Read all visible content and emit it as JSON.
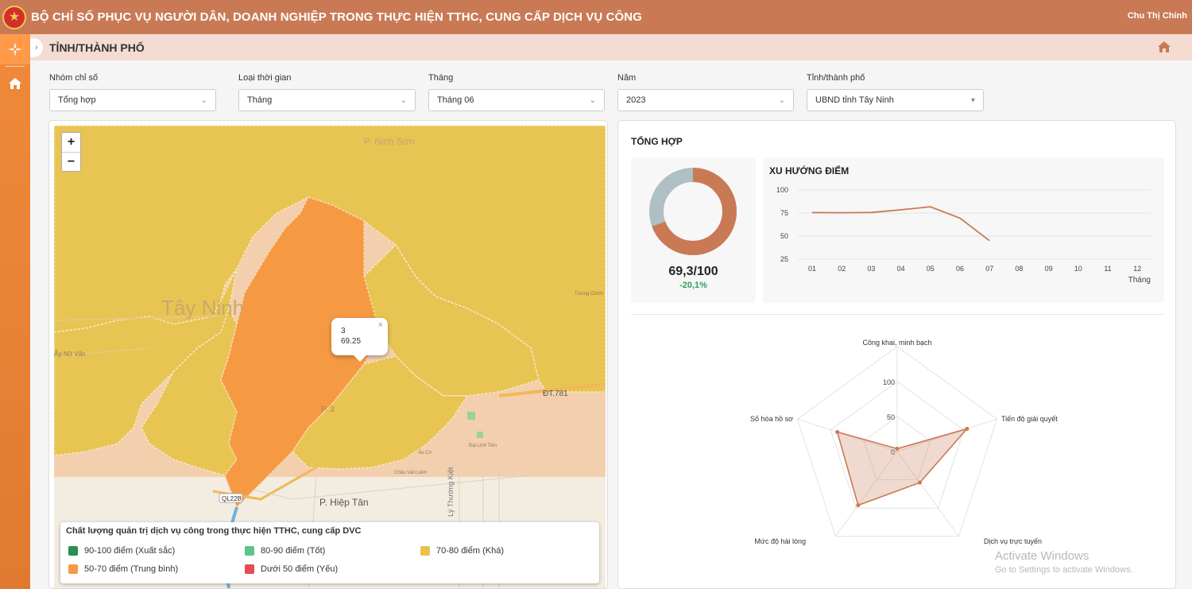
{
  "header": {
    "title": "BỘ CHỈ SỐ PHỤC VỤ NGƯỜI DÂN, DOANH NGHIỆP TRONG THỰC HIỆN TTHC, CUNG CẤP DỊCH VỤ CÔNG",
    "user": "Chu Thị Chinh"
  },
  "page": {
    "title": "TỈNH/THÀNH PHỐ"
  },
  "filters": [
    {
      "label": "Nhóm chỉ số",
      "value": "Tổng hợp"
    },
    {
      "label": "Loại thời gian",
      "value": "Tháng"
    },
    {
      "label": "Tháng",
      "value": "Tháng 06"
    },
    {
      "label": "Năm",
      "value": "2023"
    },
    {
      "label": "Tỉnh/thành phố",
      "value": "UBND tỉnh Tây Ninh"
    }
  ],
  "map": {
    "zoom_in": "+",
    "zoom_out": "−",
    "labels": {
      "ninh_son": "P. Ninh Sơn",
      "tay_ninh": "Tây Ninh",
      "hiep_tan": "P. Hiệp Tân",
      "dt781": "ĐT.781",
      "ql22b": "QL22B",
      "ly_thuong_kiet": "Lý Thường Kiệt",
      "nguyen_van_linh": "Ấp Nữ Văn",
      "tuong_chinh": "Tường Chính",
      "au_co": "Âu Cơ",
      "dai_linh_tien": "Đại Linh Tiên",
      "chau_van_liem": "Châu Văn Liêm",
      "p3": "P. 3"
    },
    "popup": {
      "id": "3",
      "value": "69.25",
      "close": "×"
    },
    "legend": {
      "title": "Chất lượng quản trị dịch vụ công trong thực hiện TTHC, cung cấp DVC",
      "items": [
        {
          "label": "90-100 điểm (Xuất sắc)",
          "color": "#2a8f4f"
        },
        {
          "label": "80-90 điểm (Tốt)",
          "color": "#5ec488"
        },
        {
          "label": "70-80 điểm (Khá)",
          "color": "#e8c24c"
        },
        {
          "label": "50-70 điểm (Trung bình)",
          "color": "#f59a42"
        },
        {
          "label": "Dưới 50 điểm (Yếu)",
          "color": "#e64b55"
        }
      ]
    }
  },
  "summary": {
    "title": "TỔNG HỢP",
    "score": "69,3/100",
    "delta": "-20,1%",
    "score_value": 69.3,
    "score_max": 100,
    "donut_colors": {
      "score": "#c97a55",
      "rest": "#b0bec5"
    }
  },
  "chart_data": [
    {
      "type": "line",
      "title": "XU HƯỚNG ĐIỂM",
      "xlabel": "Tháng",
      "ylabel": "",
      "x": [
        "01",
        "02",
        "03",
        "04",
        "05",
        "06",
        "07",
        "08",
        "09",
        "10",
        "11",
        "12"
      ],
      "yticks": [
        25,
        50,
        75,
        100
      ],
      "ylim": [
        25,
        100
      ],
      "series": [
        {
          "values": [
            75.5,
            75.3,
            75.6,
            78.5,
            81.8,
            69.5,
            45
          ]
        }
      ],
      "color": "#c97a55",
      "grid": true
    },
    {
      "type": "radar",
      "axes": [
        "Công khai, minh bạch",
        "Tiến độ giải quyết",
        "Dịch vụ trực tuyến",
        "Mức độ hài lòng",
        "Số hóa hồ sơ"
      ],
      "rticks": [
        0,
        50,
        100
      ],
      "rmax": 150,
      "series": [
        {
          "values": [
            4,
            105,
            55,
            95,
            90
          ]
        }
      ],
      "color": "#c97a55"
    }
  ],
  "os": {
    "watermark_title": "Activate Windows",
    "watermark_sub": "Go to Settings to activate Windows."
  }
}
